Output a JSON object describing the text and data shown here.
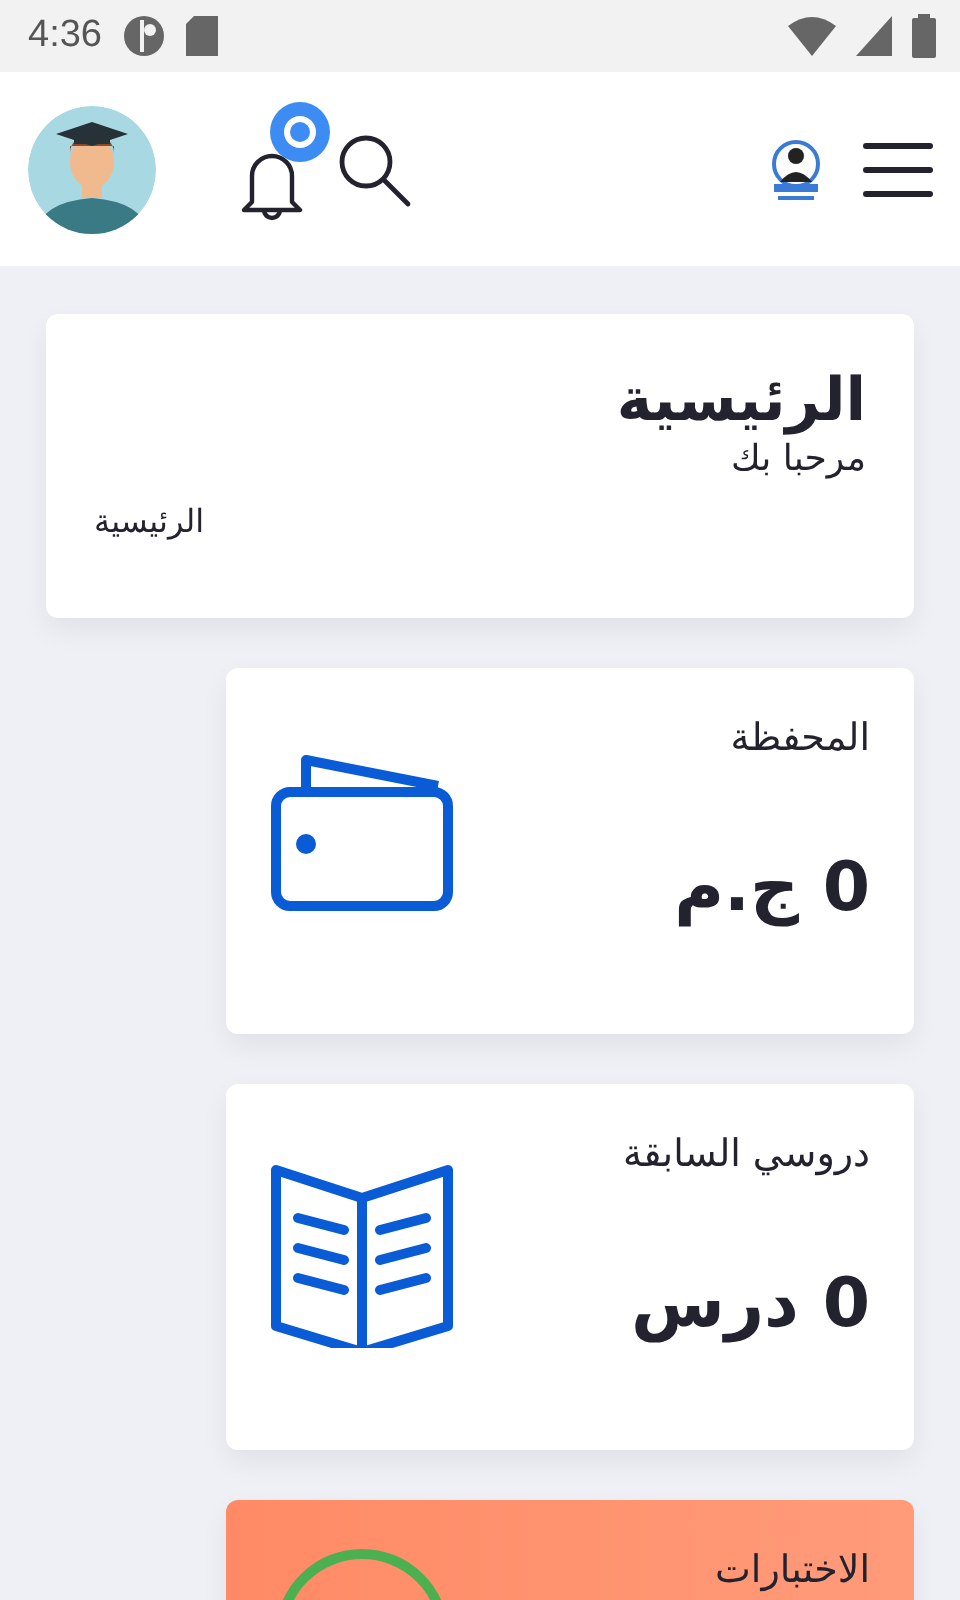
{
  "status_bar": {
    "time": "4:36"
  },
  "page_card": {
    "title": "الرئيسية",
    "subtitle": "مرحبا بك",
    "breadcrumb": "الرئيسية"
  },
  "cards": [
    {
      "kind": "wallet",
      "title": "المحفظة",
      "value": "0 ج.م"
    },
    {
      "kind": "book",
      "title": "دروسي السابقة",
      "value": "0 درس"
    },
    {
      "kind": "exam",
      "title": "الاختبارات"
    }
  ]
}
